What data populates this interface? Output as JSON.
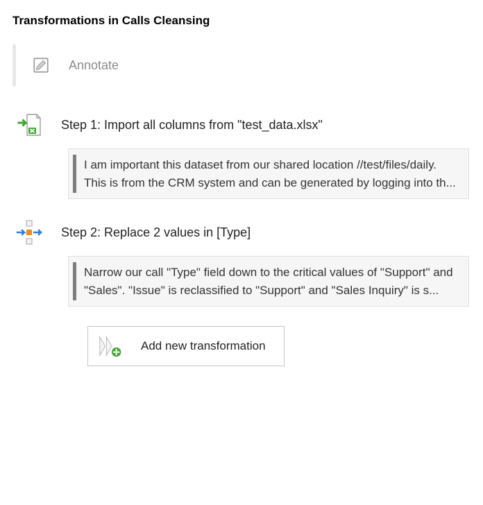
{
  "panel_title": "Transformations in Calls Cleansing",
  "annotate_label": "Annotate",
  "steps": [
    {
      "title": "Step 1: Import all columns from \"test_data.xlsx\"",
      "note": "I am important this dataset from our shared location //test/files/daily.  This is from the CRM system and can be generated by logging into th..."
    },
    {
      "title": "Step 2: Replace 2 values in [Type]",
      "note": "Narrow our call \"Type\" field down to the critical values of \"Support\" and \"Sales\". \"Issue\" is reclassified to \"Support\" and \"Sales Inquiry\" is s..."
    }
  ],
  "add_button_label": "Add new transformation",
  "colors": {
    "accent_green": "#3fa82f",
    "accent_orange": "#ed8b1c",
    "accent_blue": "#2b7fd6",
    "muted_grey": "#8c8c8c",
    "border_grey": "#c6c6c6",
    "note_bar": "#7d7d7d"
  }
}
